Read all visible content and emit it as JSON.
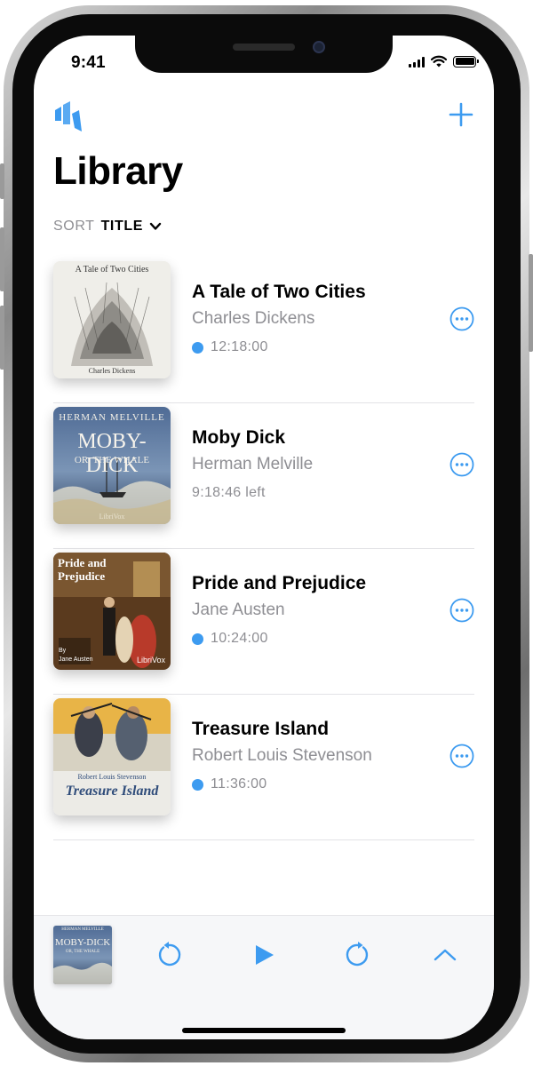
{
  "status_bar": {
    "time": "9:41"
  },
  "header": {
    "title": "Library"
  },
  "sort": {
    "label": "SORT",
    "value": "TITLE"
  },
  "colors": {
    "accent": "#3d9bf0",
    "secondary_text": "#8e8e93"
  },
  "books": [
    {
      "title": "A Tale of Two Cities",
      "author": "Charles Dickens",
      "duration": "12:18:00",
      "new_indicator": true,
      "cover": {
        "top_text": "A Tale of Two Cities",
        "bottom_text": "Charles Dickens"
      }
    },
    {
      "title": "Moby Dick",
      "author": "Herman Melville",
      "duration": "9:18:46 left",
      "new_indicator": false,
      "cover": {
        "top_text": "HERMAN MELVILLE",
        "mid_text": "MOBY-DICK",
        "sub_text": "OR, THE WHALE",
        "bottom_text": "LibriVox"
      }
    },
    {
      "title": "Pride and Prejudice",
      "author": "Jane Austen",
      "duration": "10:24:00",
      "new_indicator": true,
      "cover": {
        "top_text": "Pride and Prejudice",
        "by_text": "By",
        "author_text": "Jane Austen",
        "bottom_text": "LibriVox"
      }
    },
    {
      "title": "Treasure Island",
      "author": "Robert Louis Stevenson",
      "duration": "11:36:00",
      "new_indicator": true,
      "cover": {
        "top_text": "Robert Louis Stevenson",
        "mid_text": "Treasure Island"
      }
    }
  ],
  "player": {
    "cover": {
      "top_text": "HERMAN MELVILLE",
      "mid_text": "MOBY-DICK",
      "sub_text": "OR, THE WHALE"
    },
    "buttons": [
      "rewind-icon",
      "play-icon",
      "forward-icon",
      "chevron-up-icon"
    ]
  }
}
